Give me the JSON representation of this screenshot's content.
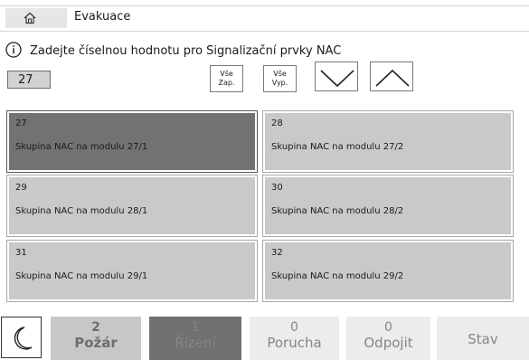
{
  "header": {
    "title": "Evakuace",
    "home_icon": "home-icon"
  },
  "prompt": {
    "icon": "info-icon",
    "text": "Zadejte číselnou hodnotu pro Signalizační prvky NAC"
  },
  "number_input": {
    "value": "27"
  },
  "buttons": {
    "all_on": {
      "line1": "Vše",
      "line2": "Zap."
    },
    "all_off": {
      "line1": "Vše",
      "line2": "Vyp."
    },
    "down_icon": "chevron-down-icon",
    "up_icon": "chevron-up-icon"
  },
  "tiles": [
    {
      "number": "27",
      "label": "Skupina NAC na modulu 27/1",
      "selected": true
    },
    {
      "number": "28",
      "label": "Skupina NAC na modulu 27/2",
      "selected": false
    },
    {
      "number": "29",
      "label": "Skupina NAC na modulu 28/1",
      "selected": false
    },
    {
      "number": "30",
      "label": "Skupina NAC na modulu 28/2",
      "selected": false
    },
    {
      "number": "31",
      "label": "Skupina NAC na modulu 29/1",
      "selected": false
    },
    {
      "number": "32",
      "label": "Skupina NAC na modulu 29/2",
      "selected": false
    }
  ],
  "status_bar": {
    "night_icon": "moon-icon",
    "pozar": {
      "count": "2",
      "label": "Požár"
    },
    "rizeni": {
      "count": "1",
      "label": "Řízení"
    },
    "porucha": {
      "count": "0",
      "label": "Porucha"
    },
    "odpojit": {
      "count": "0",
      "label": "Odpojit"
    },
    "stav": {
      "label": "Stav"
    }
  },
  "colors": {
    "tile": "#c9c9c9",
    "tile_selected": "#727272",
    "input_bg": "#d2d2d2"
  }
}
